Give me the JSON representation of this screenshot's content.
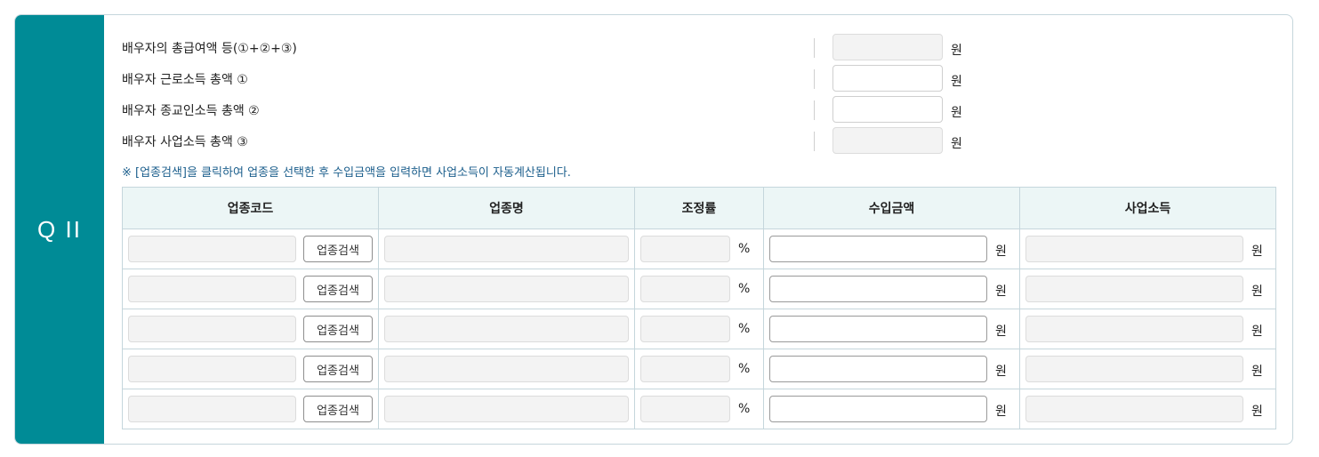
{
  "section": {
    "label": "Q II"
  },
  "summary": [
    {
      "label": "배우자의 총급여액 등(①+②+③)",
      "unit": "원",
      "readonly": true,
      "value": ""
    },
    {
      "label": "배우자 근로소득 총액 ①",
      "unit": "원",
      "readonly": false,
      "value": ""
    },
    {
      "label": "배우자 종교인소득 총액 ②",
      "unit": "원",
      "readonly": false,
      "value": ""
    },
    {
      "label": "배우자 사업소득 총액 ③",
      "unit": "원",
      "readonly": true,
      "value": ""
    }
  ],
  "note": "※ [업종검색]을 클릭하여 업종을 선택한 후 수입금액을 입력하면 사업소득이 자동계산됩니다.",
  "table": {
    "headers": [
      "업종코드",
      "업종명",
      "조정률",
      "수입금액",
      "사업소득"
    ],
    "search_button": "업종검색",
    "percent_unit": "%",
    "won_unit": "원",
    "rows": [
      {
        "code": "",
        "name": "",
        "rate": "",
        "income": "",
        "business_income": ""
      },
      {
        "code": "",
        "name": "",
        "rate": "",
        "income": "",
        "business_income": ""
      },
      {
        "code": "",
        "name": "",
        "rate": "",
        "income": "",
        "business_income": ""
      },
      {
        "code": "",
        "name": "",
        "rate": "",
        "income": "",
        "business_income": ""
      },
      {
        "code": "",
        "name": "",
        "rate": "",
        "income": "",
        "business_income": ""
      }
    ]
  }
}
